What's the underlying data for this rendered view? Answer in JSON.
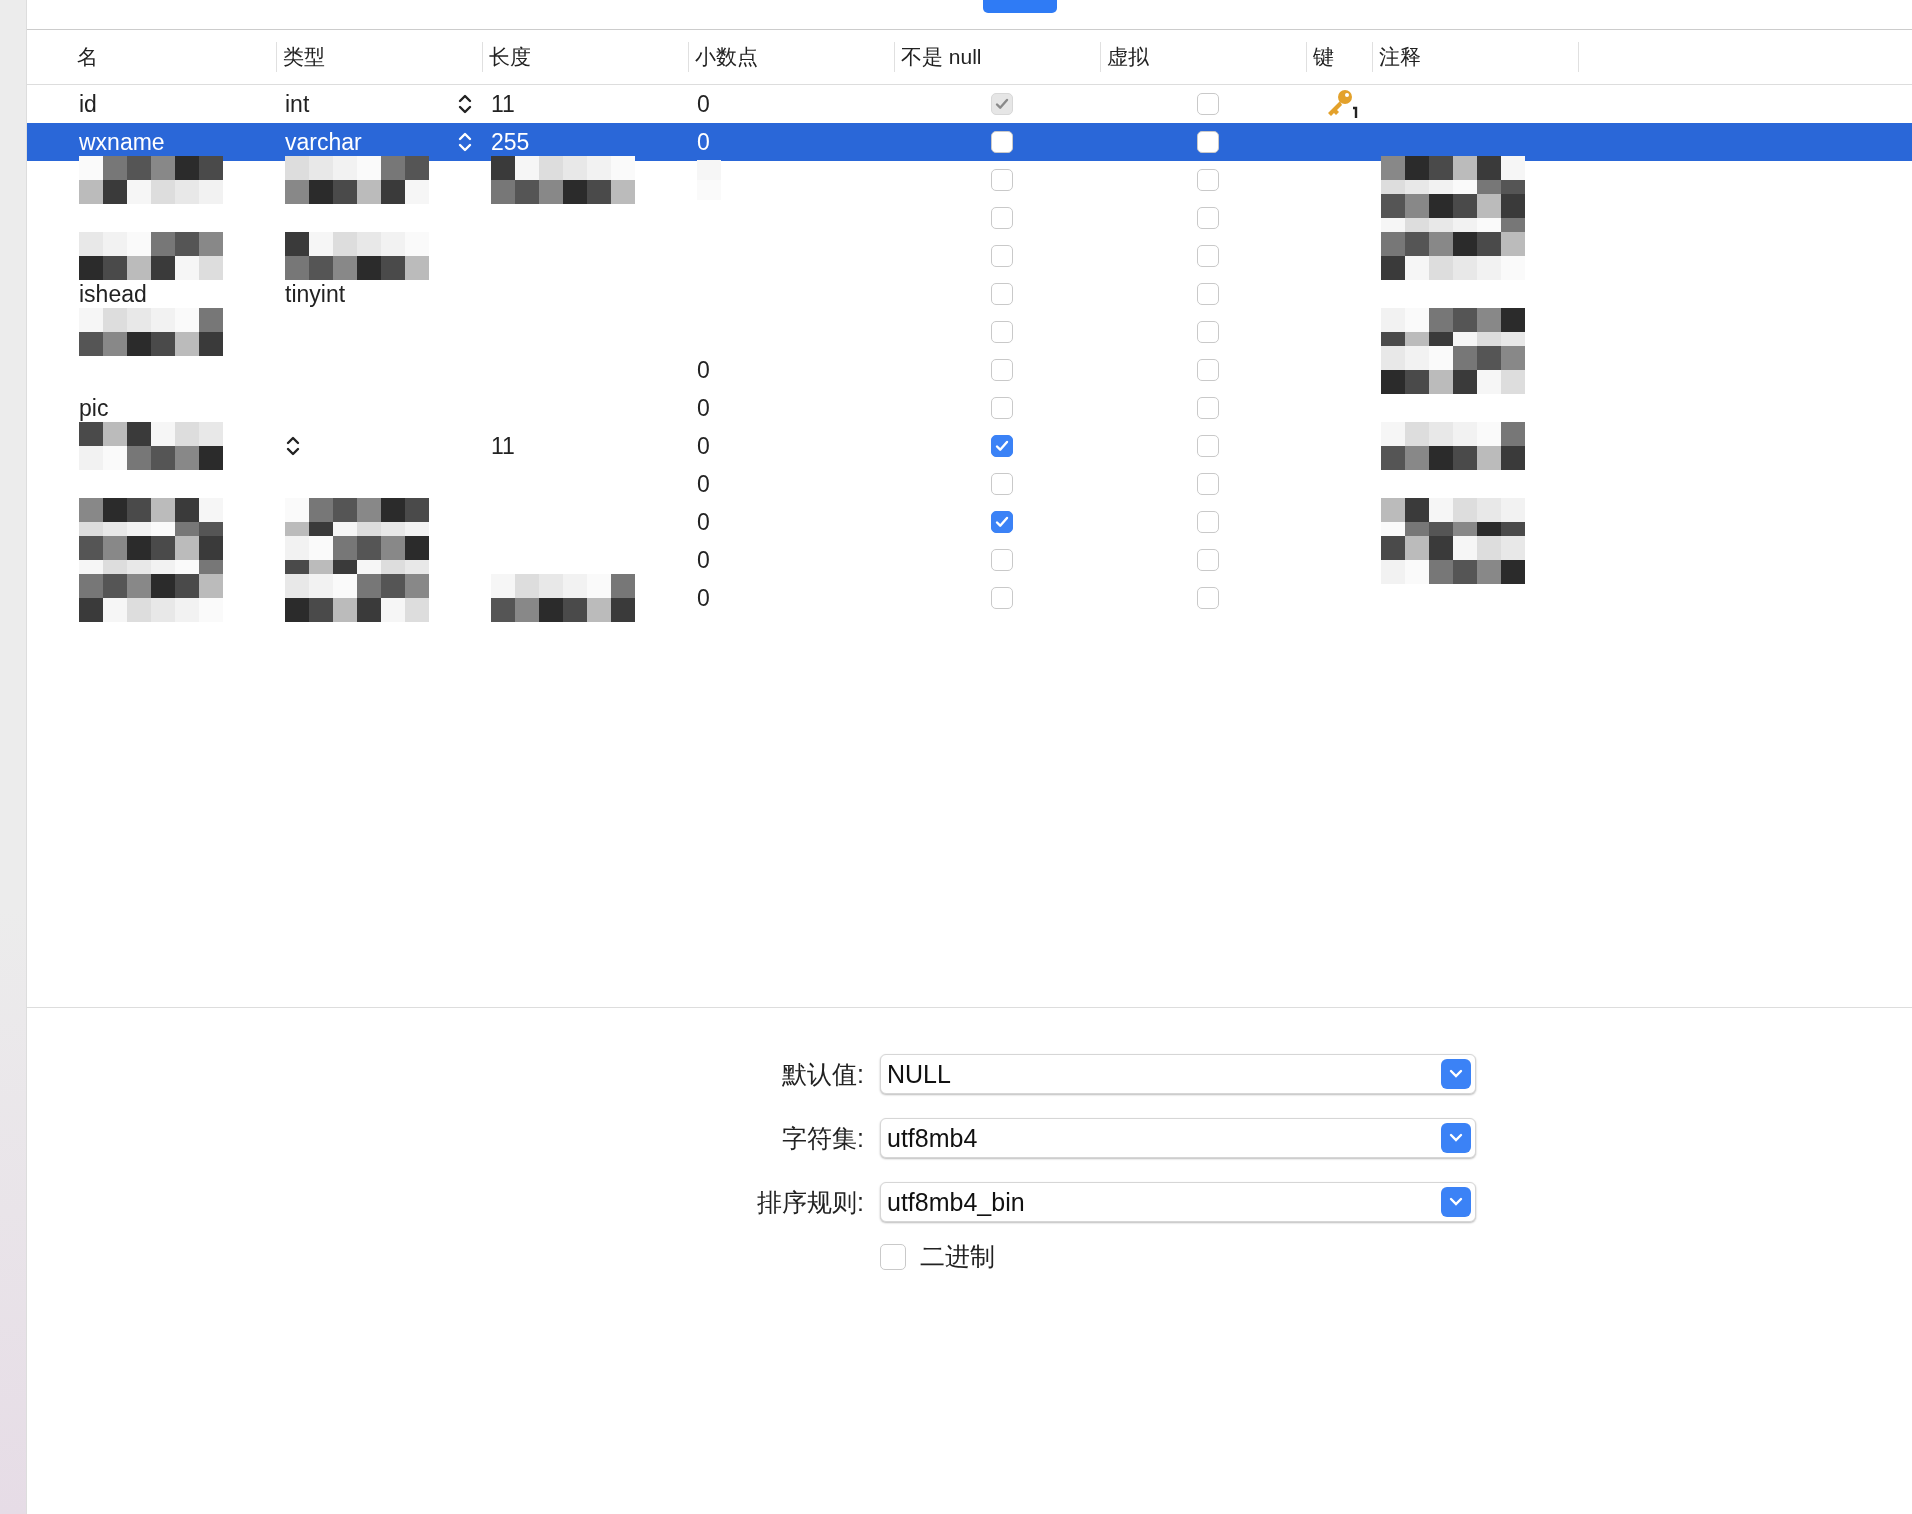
{
  "tabs": [
    {
      "selected": true
    }
  ],
  "columns": [
    "名",
    "类型",
    "长度",
    "小数点",
    "不是 null",
    "虚拟",
    "键",
    "注释"
  ],
  "rows": [
    {
      "name": "id",
      "type": "int",
      "stepper": true,
      "length": "11",
      "decimals": "0",
      "not_null": true,
      "disabled": true,
      "virtual": false,
      "primary_key": true,
      "selected": false,
      "name_hidden": false,
      "type_hidden": false,
      "length_hidden": false,
      "decimals_hidden": false,
      "comment_hidden": false
    },
    {
      "name": "wxname",
      "type": "varchar",
      "stepper": true,
      "length": "255",
      "decimals": "0",
      "not_null": false,
      "disabled": false,
      "virtual": false,
      "primary_key": false,
      "selected": true,
      "name_hidden": false,
      "type_hidden": false,
      "length_hidden": false,
      "decimals_hidden": false,
      "comment_hidden": false
    },
    {
      "stepper": false,
      "not_null": false,
      "disabled": false,
      "virtual": false,
      "primary_key": false,
      "selected": false,
      "name_hidden": true,
      "type_hidden": true,
      "length_hidden": true,
      "decimals_hidden": true,
      "comment_hidden": true
    },
    {
      "stepper": false,
      "not_null": false,
      "disabled": false,
      "virtual": false,
      "primary_key": false,
      "selected": false,
      "name_hidden": false,
      "type_hidden": false,
      "length_hidden": false,
      "decimals_hidden": false,
      "comment_hidden": true
    },
    {
      "stepper": false,
      "not_null": false,
      "disabled": false,
      "virtual": false,
      "primary_key": false,
      "selected": false,
      "name_hidden": true,
      "type_hidden": true,
      "length_hidden": false,
      "decimals_hidden": false,
      "comment_hidden": true
    },
    {
      "name": "ishead",
      "type": "tinyint",
      "stepper": false,
      "not_null": false,
      "disabled": false,
      "virtual": false,
      "primary_key": false,
      "selected": false,
      "name_hidden": false,
      "type_hidden": false,
      "length_hidden": false,
      "decimals_hidden": false,
      "comment_hidden": false
    },
    {
      "stepper": false,
      "not_null": false,
      "disabled": false,
      "virtual": false,
      "primary_key": false,
      "selected": false,
      "name_hidden": true,
      "type_hidden": false,
      "length_hidden": false,
      "decimals_hidden": false,
      "comment_hidden": true
    },
    {
      "decimals": "0",
      "stepper": false,
      "not_null": false,
      "disabled": false,
      "virtual": false,
      "primary_key": false,
      "selected": false,
      "name_hidden": false,
      "type_hidden": false,
      "length_hidden": false,
      "decimals_hidden": false,
      "comment_hidden": true
    },
    {
      "name": "pic",
      "decimals": "0",
      "stepper": false,
      "not_null": false,
      "disabled": false,
      "virtual": false,
      "primary_key": false,
      "selected": false,
      "name_hidden": false,
      "type_hidden": false,
      "length_hidden": false,
      "decimals_hidden": false,
      "comment_hidden": false
    },
    {
      "stepper": true,
      "length": "11",
      "decimals": "0",
      "not_null": true,
      "disabled": false,
      "virtual": false,
      "primary_key": false,
      "selected": false,
      "name_hidden": true,
      "type_hidden": false,
      "length_hidden": false,
      "decimals_hidden": false,
      "comment_hidden": true
    },
    {
      "decimals": "0",
      "stepper": false,
      "not_null": false,
      "disabled": false,
      "virtual": false,
      "primary_key": false,
      "selected": false,
      "name_hidden": false,
      "type_hidden": false,
      "length_hidden": false,
      "decimals_hidden": false,
      "comment_hidden": false
    },
    {
      "decimals": "0",
      "stepper": false,
      "not_null": true,
      "disabled": false,
      "virtual": false,
      "primary_key": false,
      "selected": false,
      "name_hidden": true,
      "type_hidden": true,
      "length_hidden": false,
      "decimals_hidden": false,
      "comment_hidden": true
    },
    {
      "decimals": "0",
      "stepper": false,
      "not_null": false,
      "disabled": false,
      "virtual": false,
      "primary_key": false,
      "selected": false,
      "name_hidden": true,
      "type_hidden": true,
      "length_hidden": false,
      "decimals_hidden": false,
      "comment_hidden": true
    },
    {
      "decimals": "0",
      "stepper": false,
      "not_null": false,
      "disabled": false,
      "virtual": false,
      "primary_key": false,
      "selected": false,
      "name_hidden": true,
      "type_hidden": true,
      "length_hidden": true,
      "decimals_hidden": false,
      "comment_hidden": false
    }
  ],
  "properties": [
    {
      "label": "默认值:",
      "value": "NULL"
    },
    {
      "label": "字符集:",
      "value": "utf8mb4"
    },
    {
      "label": "排序规则:",
      "value": "utf8mb4_bin"
    }
  ],
  "binary": {
    "label": "二进制",
    "checked": false
  }
}
